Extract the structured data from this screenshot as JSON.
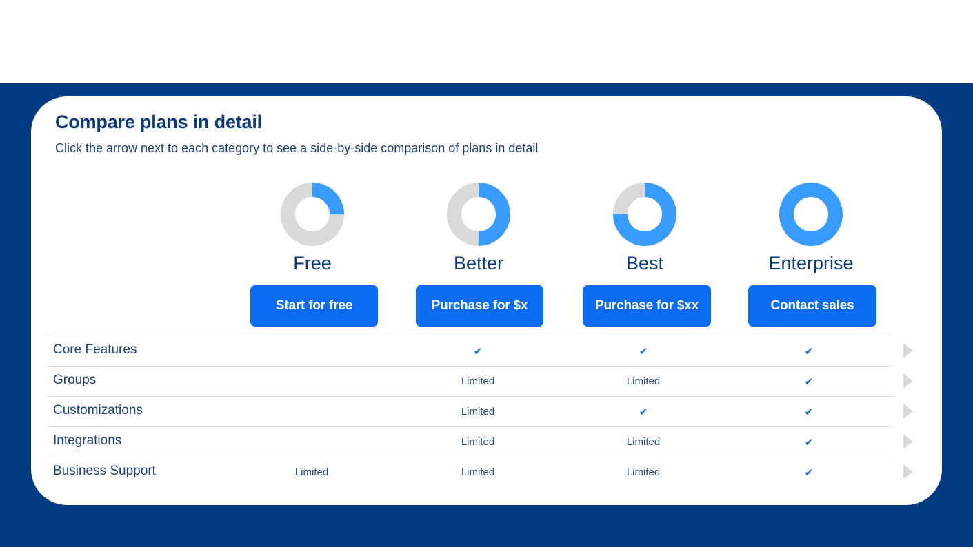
{
  "colors": {
    "band": "#003a80",
    "accent": "#0a6cf5",
    "donut_fill": "#3a9bff",
    "donut_track": "#d9d9d9"
  },
  "header": {
    "title": "Compare plans in detail",
    "subtitle": "Click the arrow next to each category to see a side-by-side comparison of plans in detail"
  },
  "plans": [
    {
      "name": "Free",
      "button": "Start for free",
      "fill_fraction": 0.25
    },
    {
      "name": "Better",
      "button": "Purchase for $x",
      "fill_fraction": 0.5
    },
    {
      "name": "Best",
      "button": "Purchase for $xx",
      "fill_fraction": 0.75
    },
    {
      "name": "Enterprise",
      "button": "Contact sales",
      "fill_fraction": 1.0
    }
  ],
  "check_glyph": "✔",
  "rows": [
    {
      "label": "Core Features",
      "values": [
        "",
        "check",
        "check",
        "check"
      ],
      "arrow_icon": "chevron-right-icon"
    },
    {
      "label": "Groups",
      "values": [
        "",
        "Limited",
        "Limited",
        "check"
      ],
      "arrow_icon": "chevron-right-icon"
    },
    {
      "label": "Customizations",
      "values": [
        "",
        "Limited",
        "check",
        "check"
      ],
      "arrow_icon": "chevron-right-icon"
    },
    {
      "label": "Integrations",
      "values": [
        "",
        "Limited",
        "Limited",
        "check"
      ],
      "arrow_icon": "chevron-right-icon"
    },
    {
      "label": "Business Support",
      "values": [
        "Limited",
        "Limited",
        "Limited",
        "check"
      ],
      "arrow_icon": "chevron-right-icon"
    }
  ]
}
